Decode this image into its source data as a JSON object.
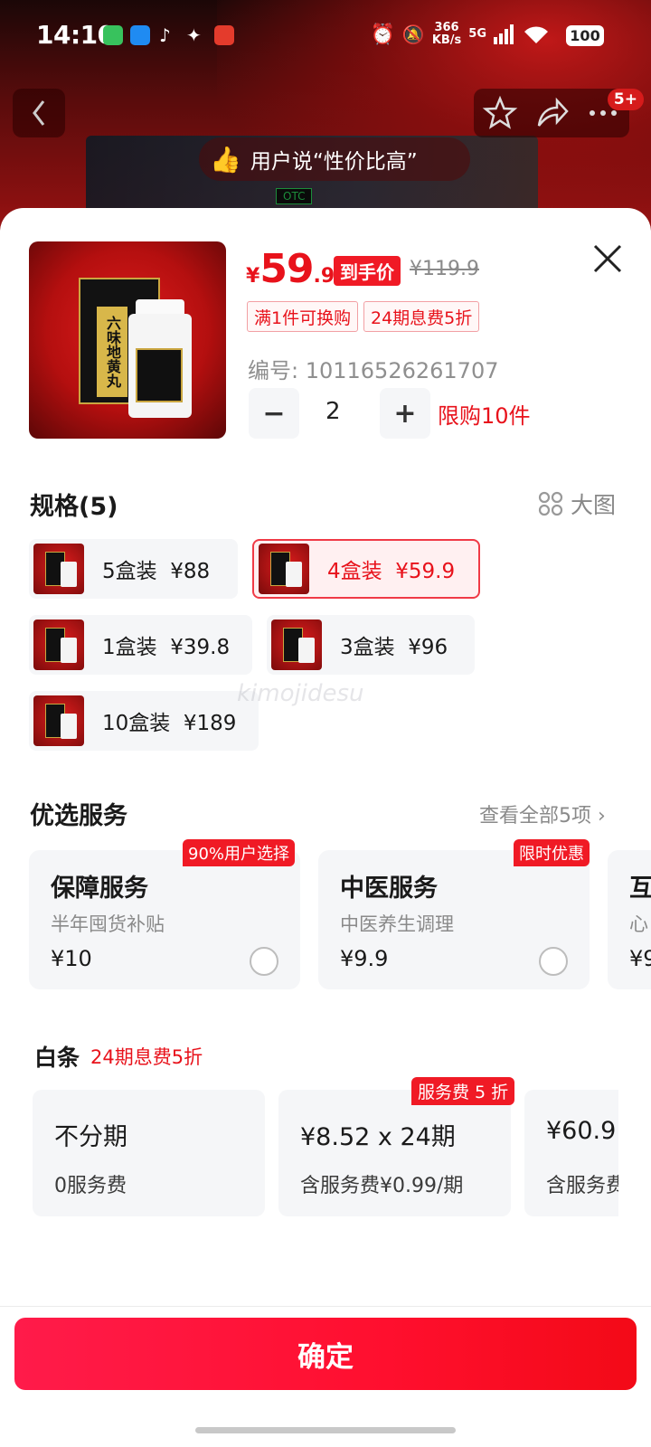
{
  "status_bar": {
    "time": "14:10",
    "net_speed": "366",
    "net_unit": "KB/s",
    "signal": "5G",
    "battery": "100"
  },
  "header": {
    "notifications": "5+",
    "promo_text": "用户说“性价比高”",
    "otc_label": "OTC"
  },
  "product": {
    "name_on_box": "六味地黄丸",
    "price_symbol": "¥",
    "price_int": "59",
    "price_dec": ".9",
    "price_label": "到手价",
    "original_price": "¥119.9",
    "tags": [
      "满1件可换购",
      "24期息费5折"
    ],
    "code": "编号: 10116526261707",
    "quantity": "2",
    "minus": "−",
    "plus": "+",
    "limit": "限购10件"
  },
  "spec": {
    "title": "规格(5)",
    "big_pic_label": "大图",
    "options": [
      {
        "label": "5盒装  ¥88"
      },
      {
        "label": "4盒装  ¥59.9",
        "selected": true
      },
      {
        "label": "1盒装  ¥39.8"
      },
      {
        "label": "3盒装  ¥96"
      },
      {
        "label": "10盒装  ¥189"
      }
    ]
  },
  "watermark": "kimojidesu",
  "services": {
    "title": "优选服务",
    "view_all": "查看全部5项 ›",
    "items": [
      {
        "badge": "90%用户选择",
        "title": "保障服务",
        "subtitle": "半年囤货补贴",
        "price": "¥10"
      },
      {
        "badge": "限时优惠",
        "title": "中医服务",
        "subtitle": "中医养生调理",
        "price": "¥9.9"
      },
      {
        "title": "互",
        "subtitle": "心",
        "price": "¥9"
      }
    ]
  },
  "baitiao": {
    "title": "白条",
    "promo": "24期息费5折",
    "fee_badge": "服务费 5 折",
    "options": [
      {
        "main": "不分期",
        "sub": "0服务费"
      },
      {
        "main": "¥8.52 x 24期",
        "sub": "含服务费¥0.99/期"
      },
      {
        "main": "¥60.9",
        "sub": "含服务费"
      }
    ]
  },
  "confirm_label": "确定",
  "colors": {
    "accent": "#e8121b",
    "button": "#ff1b3a",
    "header_bg": "#6a0c0c"
  }
}
